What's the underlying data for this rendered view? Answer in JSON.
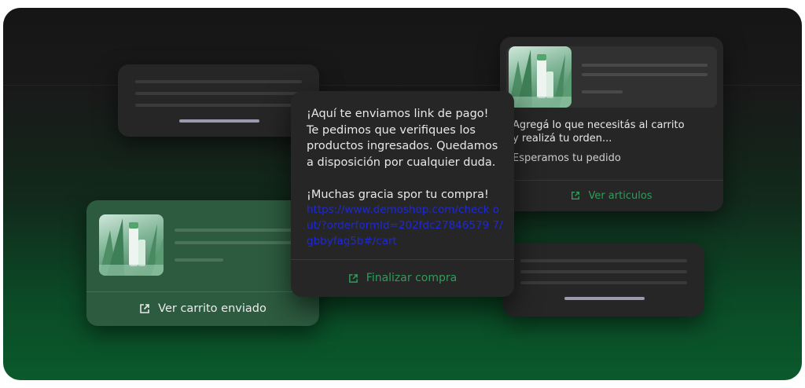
{
  "payment_message": {
    "text": "¡Aquí te enviamos link de pago!\nTe pedimos que verifiques los productos ingresados. Quedamos a disposición por cualquier duda.\n\n¡Muchas gracia spor tu compra!",
    "link": "https://www.demoshop.com/check out/?orderformId=202fdc27846579 7/gbbyfag5b#/cart",
    "action_label": "Finalizar compra",
    "action_icon": "external-link-icon"
  },
  "cart_card": {
    "action_label": "Ver carrito enviado",
    "action_icon": "external-link-icon"
  },
  "articles_card": {
    "text": "Agregá lo que necesitás al carrito\ny realizá tu orden...",
    "subtext": "Esperamos tu pedido",
    "action_label": "Ver articulos",
    "action_icon": "external-link-icon"
  },
  "colors": {
    "card_dark": "#262626",
    "card_green": "#2d5b3f",
    "accent_green": "#2f9c5a",
    "link_blue": "#1d28d6"
  }
}
